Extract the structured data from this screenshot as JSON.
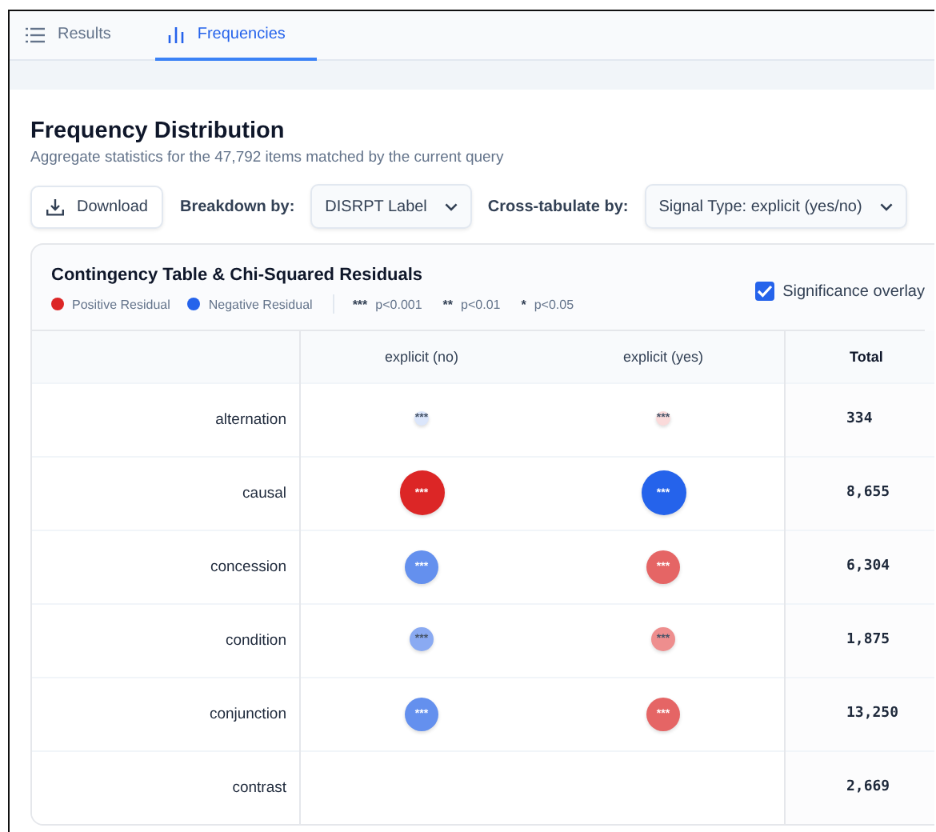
{
  "tabs": [
    {
      "label": "Results",
      "selected": false
    },
    {
      "label": "Frequencies",
      "selected": true
    }
  ],
  "heading": "Frequency Distribution",
  "subtitle": "Aggregate statistics for the 47,792 items matched by the current query",
  "toolbar": {
    "download": "Download",
    "breakdown_label": "Breakdown by:",
    "breakdown_value": "DISRPT Label",
    "crosstab_label": "Cross-tabulate by:",
    "crosstab_value": "Signal Type: explicit (yes/no)"
  },
  "card": {
    "title": "Contingency Table & Chi-Squared Residuals",
    "legend": [
      {
        "label": "Positive Residual",
        "color": "#dc2626"
      },
      {
        "label": "Negative Residual",
        "color": "#2563eb"
      }
    ],
    "significance_keys": [
      {
        "stars": "***",
        "label": "p<0.001"
      },
      {
        "stars": "**",
        "label": "p<0.01"
      },
      {
        "stars": "*",
        "label": "p<0.05"
      }
    ],
    "overlay": {
      "label": "Significance overlay",
      "checked": true
    }
  },
  "table": {
    "columns": [
      "explicit (no)",
      "explicit (yes)",
      "Total"
    ],
    "rows": [
      {
        "label": "alternation",
        "total": "334",
        "cells": [
          {
            "text": "***",
            "color": "#dbe6fb",
            "kind": "tiny"
          },
          {
            "text": "***",
            "color": "#fadada",
            "kind": "tiny"
          }
        ]
      },
      {
        "label": "causal",
        "total": "8,655",
        "cells": [
          {
            "text": "***",
            "color": "#dc2626",
            "kind": "large"
          },
          {
            "text": "***",
            "color": "#2563eb",
            "kind": "large"
          }
        ]
      },
      {
        "label": "concession",
        "total": "6,304",
        "cells": [
          {
            "text": "***",
            "color": "#6490ee",
            "kind": "medium"
          },
          {
            "text": "***",
            "color": "#e56565",
            "kind": "medium"
          }
        ]
      },
      {
        "label": "condition",
        "total": "1,875",
        "cells": [
          {
            "text": "***",
            "color": "#8aaaf2",
            "kind": "small"
          },
          {
            "text": "***",
            "color": "#ee8e8e",
            "kind": "small"
          }
        ]
      },
      {
        "label": "conjunction",
        "total": "13,250",
        "cells": [
          {
            "text": "***",
            "color": "#6490ee",
            "kind": "medium"
          },
          {
            "text": "***",
            "color": "#e56565",
            "kind": "medium"
          }
        ]
      },
      {
        "label": "contrast",
        "total": "2,669"
      }
    ]
  }
}
